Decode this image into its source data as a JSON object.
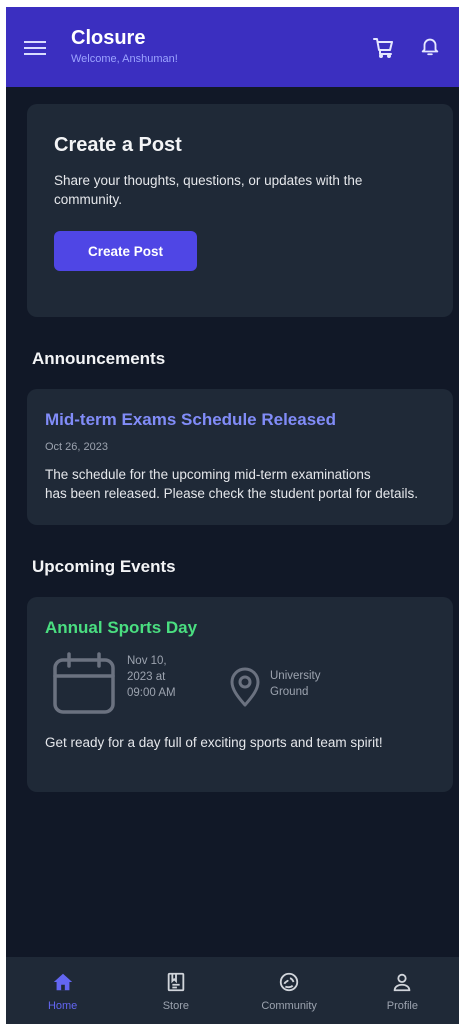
{
  "header": {
    "title": "Closure",
    "subtitle": "Welcome, Anshuman!",
    "menu_icon": "menu-icon",
    "cart_icon": "cart-icon",
    "bell_icon": "bell-icon",
    "background": "#3b2fc0"
  },
  "create_post": {
    "title": "Create a Post",
    "description": "Share your thoughts, questions, or updates with the community.",
    "button_label": "Create Post"
  },
  "announcements": {
    "heading": "Announcements",
    "items": [
      {
        "title": "Mid-term Exams Schedule Released",
        "date": "Oct 26, 2023",
        "body_line1": "The schedule for the upcoming mid-term examinations",
        "body_line2": "has been released. Please check the student portal for details."
      }
    ]
  },
  "events": {
    "heading": "Upcoming Events",
    "items": [
      {
        "title": "Annual Sports Day",
        "date_line1": "Nov 10,",
        "date_line2": "2023 at",
        "date_line3": "09:00 AM",
        "location_line1": "University",
        "location_line2": "Ground",
        "description": "Get ready for a day full of exciting sports and team spirit!",
        "calendar_icon": "calendar-icon",
        "location_icon": "map-pin-icon"
      }
    ]
  },
  "bottom_nav": {
    "items": [
      {
        "label": "Home",
        "icon": "home-icon",
        "active": true
      },
      {
        "label": "Store",
        "icon": "store-icon",
        "active": false
      },
      {
        "label": "Community",
        "icon": "community-icon",
        "active": false
      },
      {
        "label": "Profile",
        "icon": "profile-icon",
        "active": false
      }
    ]
  },
  "colors": {
    "background": "#111827",
    "card": "#1f2937",
    "accent": "#4f46e5",
    "announcement_title": "#818cf8",
    "event_title": "#4ade80"
  }
}
